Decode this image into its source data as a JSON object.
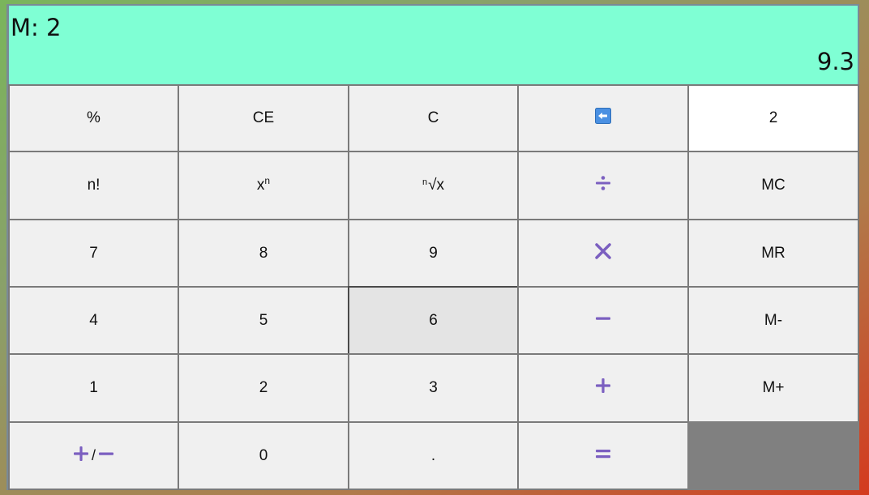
{
  "display": {
    "memory_label": "M: 2",
    "result": "9.3"
  },
  "keys": {
    "percent": "%",
    "clear_entry": "CE",
    "clear": "C",
    "memory_value": "2",
    "factorial": "n!",
    "power_base": "x",
    "power_exp": "n",
    "root_index": "n",
    "root_body": "√x",
    "memory_clear": "MC",
    "seven": "7",
    "eight": "8",
    "nine": "9",
    "memory_recall": "MR",
    "four": "4",
    "five": "5",
    "six": "6",
    "memory_subtract": "M-",
    "one": "1",
    "two": "2",
    "three": "3",
    "memory_add": "M+",
    "zero": "0",
    "decimal": ".",
    "sign_separator": "/"
  },
  "colors": {
    "display_bg": "#7fffd4",
    "operator": "#7b5fc0",
    "backspace_icon": "#4a90e2",
    "pressed_key": "#e4e4e4"
  },
  "icons": {
    "backspace": "backspace-icon",
    "divide": "divide-icon",
    "multiply": "multiply-icon",
    "subtract": "minus-icon",
    "add": "plus-icon",
    "equals": "equals-icon"
  }
}
